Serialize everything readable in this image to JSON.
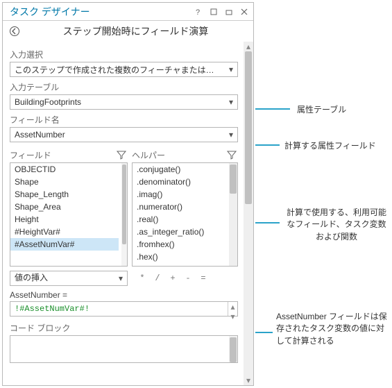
{
  "titlebar": {
    "title": "タスク デザイナー"
  },
  "subtitle": "ステップ開始時にフィールド演算",
  "inputSelection": {
    "label": "入力選択",
    "value": "このステップで作成された複数のフィーチャまたはレコード"
  },
  "inputTable": {
    "label": "入力テーブル",
    "value": "BuildingFootprints"
  },
  "fieldName": {
    "label": "フィールド名",
    "value": "AssetNumber"
  },
  "fields": {
    "label": "フィールド",
    "items": [
      "OBJECTID",
      "Shape",
      "Shape_Length",
      "Shape_Area",
      "Height",
      "#HeightVar#",
      "#AssetNumVar#"
    ],
    "selectedIndex": 6
  },
  "helpers": {
    "label": "ヘルパー",
    "items": [
      ".conjugate()",
      ".denominator()",
      ".imag()",
      ".numerator()",
      ".real()",
      ".as_integer_ratio()",
      ".fromhex()",
      ".hex()"
    ]
  },
  "insert": {
    "label": "値の挿入"
  },
  "ops": [
    "*",
    "/",
    "+",
    "-",
    "="
  ],
  "expr": {
    "label": "AssetNumber =",
    "value": "!#AssetNumVar#!"
  },
  "codeBlock": {
    "label": "コード ブロック"
  },
  "annotations": {
    "a1": "属性テーブル",
    "a2": "計算する属性フィールド",
    "a3": "計算で使用する、利用可能なフィールド、タスク変数および関数",
    "a4": "AssetNumber フィールドは保存されたタスク変数の値に対して計算される"
  }
}
